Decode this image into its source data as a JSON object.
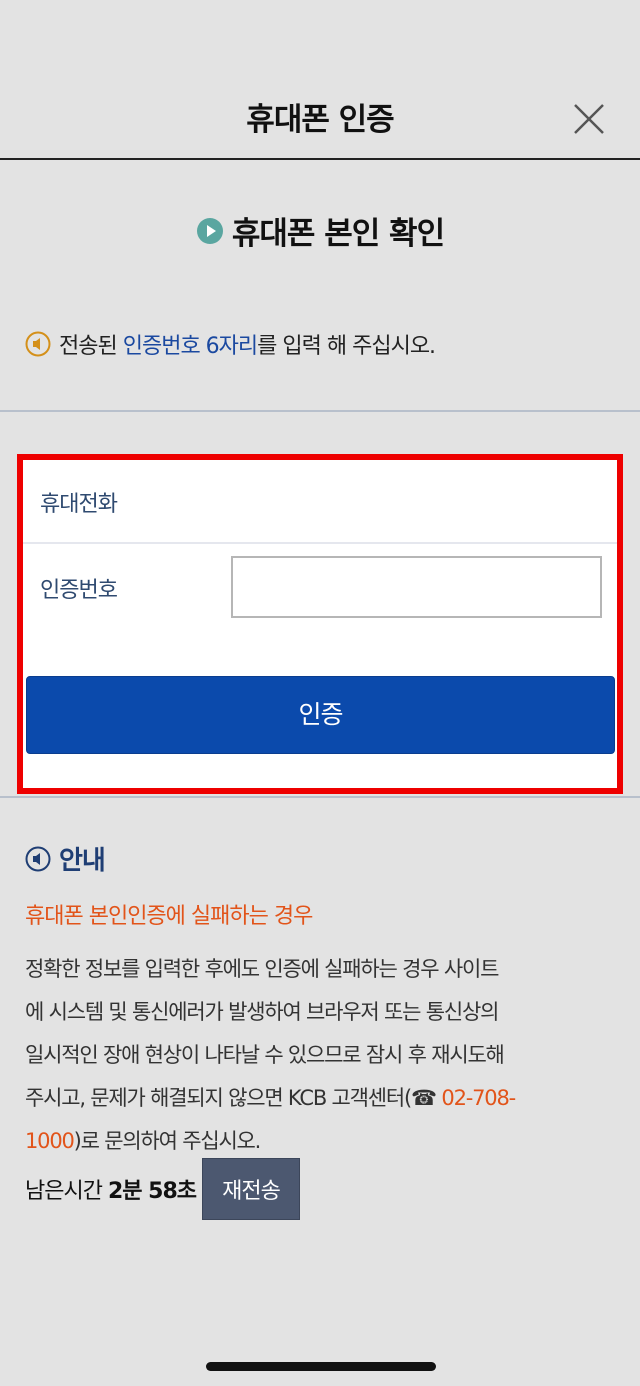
{
  "header": {
    "title": "휴대폰 인증",
    "close_icon": "close-icon"
  },
  "section": {
    "title": "휴대폰 본인 확인",
    "icon": "play-circle-icon"
  },
  "instruction": {
    "icon": "speaker-icon",
    "prefix": "전송된 ",
    "highlight": "인증번호 6자리",
    "suffix": "를 입력 해 주십시오."
  },
  "form": {
    "phone_label": "휴대전화",
    "code_label": "인증번호",
    "code_value": "",
    "code_placeholder": "",
    "verify_button": "인증"
  },
  "notice": {
    "icon": "speaker-icon",
    "title": "안내",
    "subtitle": "휴대폰 본인인증에 실패하는 경우",
    "body_line1": "정확한 정보를 입력한 후에도 인증에 실패하는 경우 사이트",
    "body_line2": "에 시스템 및 통신에러가 발생하여 브라우저 또는 통신상의",
    "body_line3": "일시적인 장애 현상이 나타날 수 있으므로 잠시 후 재시도해",
    "body_line4_prefix": "주시고, 문제가 해결되지 않으면 KCB 고객센터(",
    "phone_icon": "phone-icon",
    "phone_part1": " 02-708-",
    "phone_part2": "1000",
    "body_line5_suffix": ")로 문의하여 주십시오."
  },
  "timer": {
    "label": "남은시간",
    "value": "2분 58초",
    "resend_button": "재전송"
  },
  "colors": {
    "background": "#e3e3e3",
    "primary": "#0b4aac",
    "highlight_blue": "#1b49a0",
    "highlight_orange": "#e2541a",
    "frame_red": "#ee0000",
    "resend": "#4c5870"
  }
}
